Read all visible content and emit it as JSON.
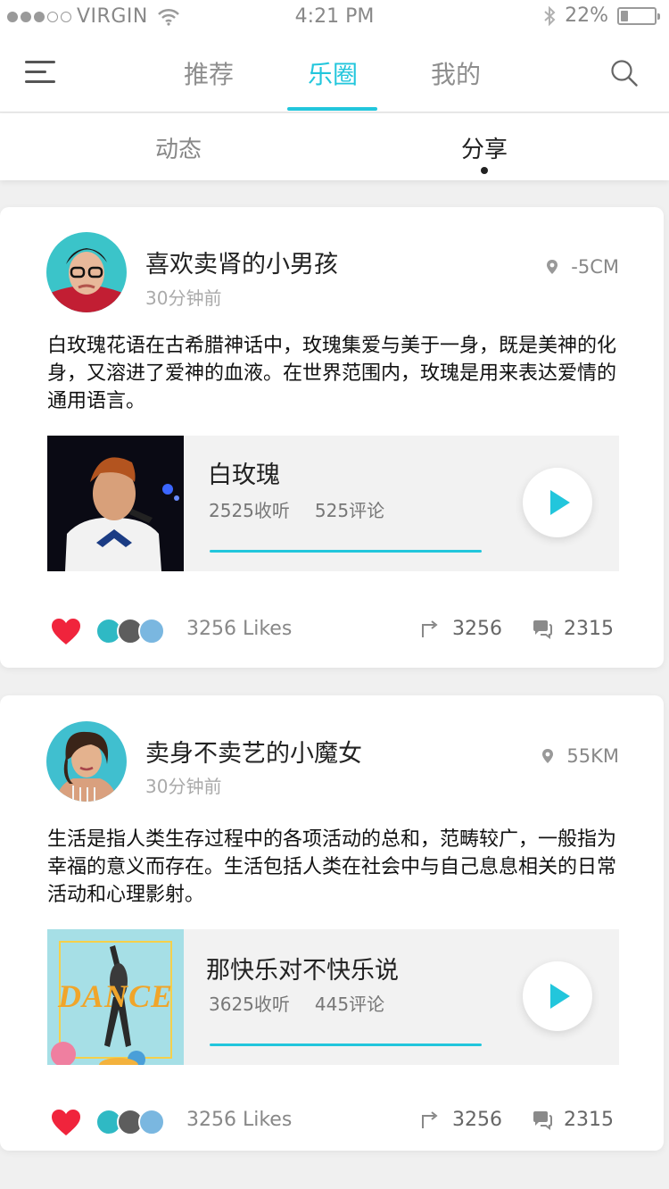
{
  "status_bar": {
    "carrier": "VIRGIN",
    "time": "4:21 PM",
    "battery": "22%",
    "battery_level": 0.22
  },
  "top_nav": {
    "tabs": [
      {
        "label": "推荐"
      },
      {
        "label": "乐圈"
      },
      {
        "label": "我的"
      }
    ],
    "active_tab": "乐圈"
  },
  "sub_nav": {
    "tabs": [
      {
        "label": "动态"
      },
      {
        "label": "分享"
      }
    ],
    "active_tab": "分享"
  },
  "posts": [
    {
      "username": "喜欢卖肾的小男孩",
      "time": "30分钟前",
      "location": "-5CM",
      "text": "白玫瑰花语在古希腊神话中，玫瑰集爱与美于一身，既是美神的化身，又溶进了爱神的血液。在世界范围内，玫瑰是用来表达爱情的通用语言。",
      "song": {
        "title": "白玫瑰",
        "listens": "2525收听",
        "comments": "525评论"
      },
      "likes": "3256 Likes",
      "shares": "3256",
      "comment_count": "2315"
    },
    {
      "username": "卖身不卖艺的小魔女",
      "time": "30分钟前",
      "location": "55KM",
      "text": "生活是指人类生存过程中的各项活动的总和，范畴较广，一般指为幸福的意义而存在。生活包括人类在社会中与自己息息相关的日常活动和心理影射。",
      "song": {
        "title": "那快乐对不快乐说",
        "listens": "3625收听",
        "comments": "445评论",
        "cover_text": "DANCE"
      },
      "likes": "3256 Likes",
      "shares": "3256",
      "comment_count": "2315"
    }
  ],
  "colors": {
    "accent": "#22c6dc",
    "heart": "#f0243c"
  }
}
